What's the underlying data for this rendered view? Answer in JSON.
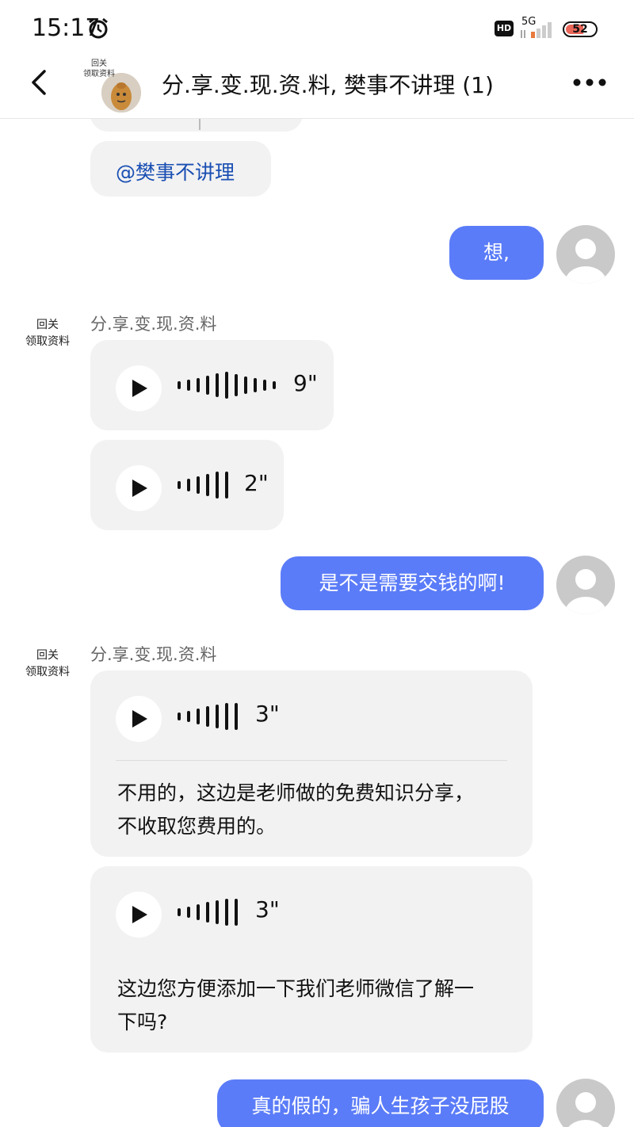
{
  "status_bar": {
    "time": "15:17",
    "hd_label": "HD",
    "network": "5G",
    "battery": "52"
  },
  "nav": {
    "title": "分.享.变.现.资.料, 樊事不讲理 (1)",
    "avatar_label": "回关\n领取资料"
  },
  "messages": {
    "mention_text": "@樊事不讲理",
    "out_1": "想,",
    "sender_label": "回关\n领取资料",
    "sender_name": "分.享.变.现.资.料",
    "voice_1_duration": "9\"",
    "voice_2_duration": "2\"",
    "out_2": "是不是需要交钱的啊!",
    "voice_3_duration": "3\"",
    "voice_3_transcript_line1": "不用的，这边是老师做的免费知识分享，",
    "voice_3_transcript_line2": "不收取您费用的。",
    "voice_4_duration": "3\"",
    "voice_4_transcript_line1": "这边您方便添加一下我们老师微信了解一",
    "voice_4_transcript_line2": "下吗?",
    "out_3": "真的假的，骗人生孩子没屁股"
  },
  "colors": {
    "accent_blue": "#5b7cf8",
    "incoming_bubble": "#f2f2f2"
  }
}
